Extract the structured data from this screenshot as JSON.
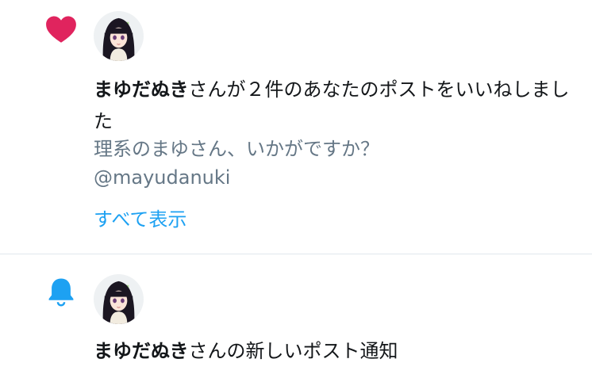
{
  "notifications": [
    {
      "type_icon": "heart-icon",
      "icon_color": "#e0245e",
      "user_name": "まゆだぬき",
      "action_text": "さんが２件のあなたのポストをいいねしました",
      "post_preview": "理系のまゆさん、いかがですか？",
      "post_handle": "@mayudanuki",
      "show_all_label": "すべて表示"
    },
    {
      "type_icon": "bell-icon",
      "icon_color": "#1da1f2",
      "user_name": "まゆだぬき",
      "action_text": "さんの新しいポスト通知"
    }
  ],
  "colors": {
    "link": "#1da1f2",
    "secondary_text": "#657786",
    "divider": "#e1e8ed"
  }
}
